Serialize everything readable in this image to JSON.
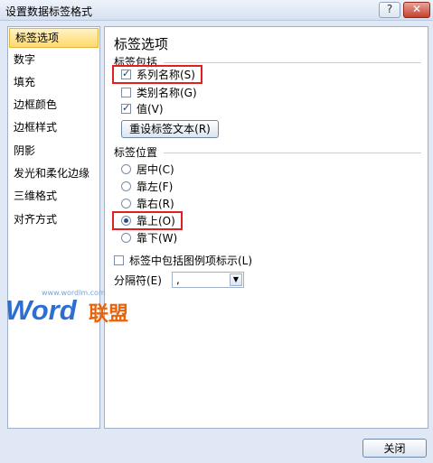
{
  "window": {
    "title": "设置数据标签格式",
    "help_glyph": "?",
    "close_glyph": "✕"
  },
  "sidebar": {
    "items": [
      {
        "label": "标签选项",
        "active": true
      },
      {
        "label": "数字"
      },
      {
        "label": "填充"
      },
      {
        "label": "边框颜色"
      },
      {
        "label": "边框样式"
      },
      {
        "label": "阴影"
      },
      {
        "label": "发光和柔化边缘"
      },
      {
        "label": "三维格式"
      },
      {
        "label": "对齐方式"
      }
    ]
  },
  "panel": {
    "title": "标签选项",
    "contains": {
      "heading": "标签包括",
      "series_name": {
        "label": "系列名称(S)",
        "checked": true
      },
      "category_name": {
        "label": "类别名称(G)",
        "checked": false
      },
      "value": {
        "label": "值(V)",
        "checked": true
      },
      "reset_button": "重设标签文本(R)"
    },
    "position": {
      "heading": "标签位置",
      "options": [
        {
          "label": "居中(C)",
          "selected": false
        },
        {
          "label": "靠左(F)",
          "selected": false
        },
        {
          "label": "靠右(R)",
          "selected": false
        },
        {
          "label": "靠上(O)",
          "selected": true
        },
        {
          "label": "靠下(W)",
          "selected": false
        }
      ]
    },
    "legend_key": {
      "label": "标签中包括图例项标示(L)",
      "checked": false
    },
    "separator": {
      "label": "分隔符(E)",
      "value": ","
    }
  },
  "watermark": {
    "site": "www.wordlm.com",
    "word": "Word",
    "cn": "联盟"
  },
  "footer": {
    "close_button": "关闭"
  },
  "colors": {
    "highlight": "#e02020",
    "accent": "#ffd96a"
  }
}
